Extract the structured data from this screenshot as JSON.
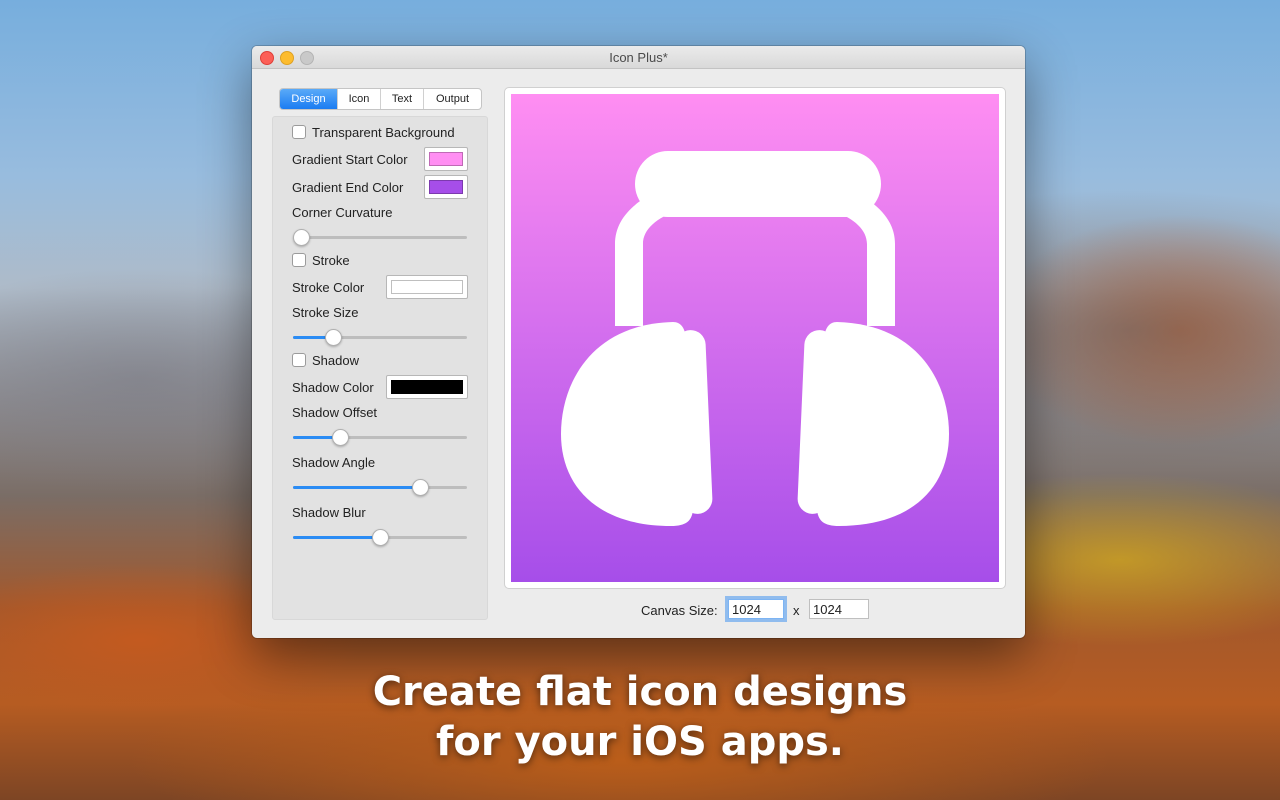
{
  "window": {
    "title": "Icon Plus*"
  },
  "tabs": [
    {
      "label": "Design",
      "active": true
    },
    {
      "label": "Icon",
      "active": false
    },
    {
      "label": "Text",
      "active": false
    },
    {
      "label": "Output",
      "active": false
    }
  ],
  "design": {
    "transparent_background": {
      "label": "Transparent Background",
      "checked": false
    },
    "gradient_start": {
      "label": "Gradient Start Color",
      "color": "#ff8ef2"
    },
    "gradient_end": {
      "label": "Gradient End Color",
      "color": "#a64ee9"
    },
    "corner_curvature": {
      "label": "Corner Curvature",
      "value": 0.0
    },
    "stroke": {
      "label": "Stroke",
      "checked": false
    },
    "stroke_color": {
      "label": "Stroke Color",
      "color": "#ffffff"
    },
    "stroke_size": {
      "label": "Stroke Size",
      "value": 0.23
    },
    "shadow": {
      "label": "Shadow",
      "checked": false
    },
    "shadow_color": {
      "label": "Shadow Color",
      "color": "#000000"
    },
    "shadow_offset": {
      "label": "Shadow Offset",
      "value": 0.27
    },
    "shadow_angle": {
      "label": "Shadow Angle",
      "value": 0.73
    },
    "shadow_blur": {
      "label": "Shadow Blur",
      "value": 0.5
    }
  },
  "preview": {
    "icon": "headphones-icon",
    "icon_color": "#ffffff"
  },
  "canvas_size": {
    "label": "Canvas Size:",
    "width": "1024",
    "separator": "x",
    "height": "1024"
  },
  "caption": {
    "line1": "Create flat icon designs",
    "line2": "for your iOS apps."
  }
}
